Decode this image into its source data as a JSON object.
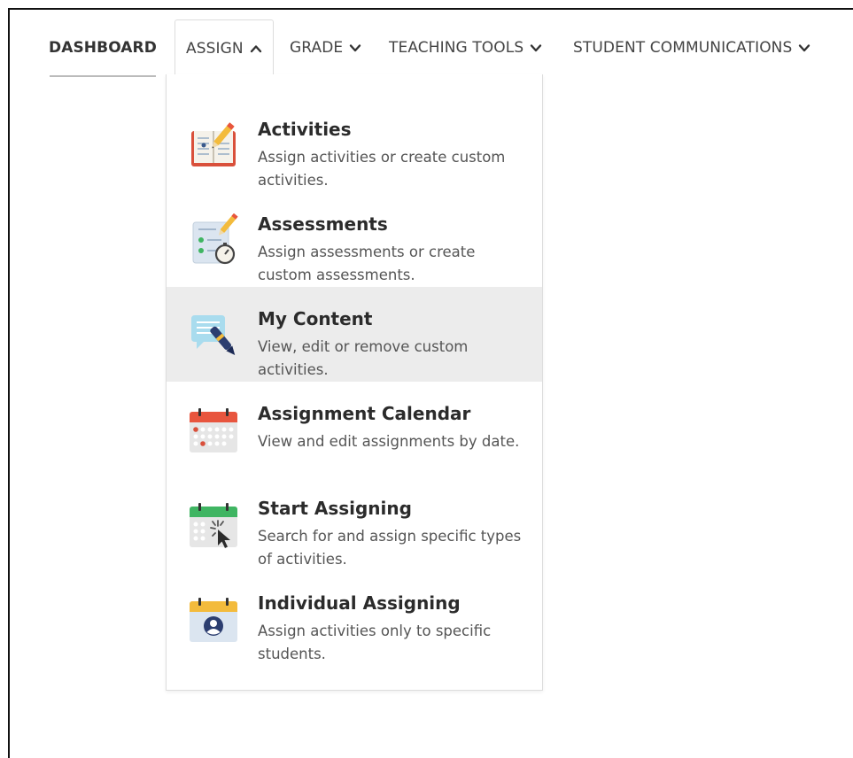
{
  "nav": {
    "dashboard": "DASHBOARD",
    "assign": "ASSIGN",
    "grade": "GRADE",
    "teaching_tools": "TEACHING TOOLS",
    "student_communications": "STUDENT COMMUNICATIONS"
  },
  "menu": [
    {
      "title": "Activities",
      "desc": "Assign activities or create custom activities.",
      "icon": "book-pencil-icon"
    },
    {
      "title": "Assessments",
      "desc": "Assign assessments or create custom assessments.",
      "icon": "checklist-timer-icon"
    },
    {
      "title": "My Content",
      "desc": "View, edit or remove custom activities.",
      "icon": "note-pen-icon"
    },
    {
      "title": "Assignment Calendar",
      "desc": "View and edit assignments by date.",
      "icon": "red-calendar-icon"
    },
    {
      "title": "Start Assigning",
      "desc": "Search for and assign specific types of activities.",
      "icon": "calendar-cursor-icon"
    },
    {
      "title": "Individual Assigning",
      "desc": "Assign activities only to specific students.",
      "icon": "calendar-user-icon"
    }
  ],
  "colors": {
    "highlight": "#ececec",
    "calendar_red": "#e8553e",
    "calendar_green": "#3fb562",
    "calendar_yellow": "#f3bb3c"
  }
}
